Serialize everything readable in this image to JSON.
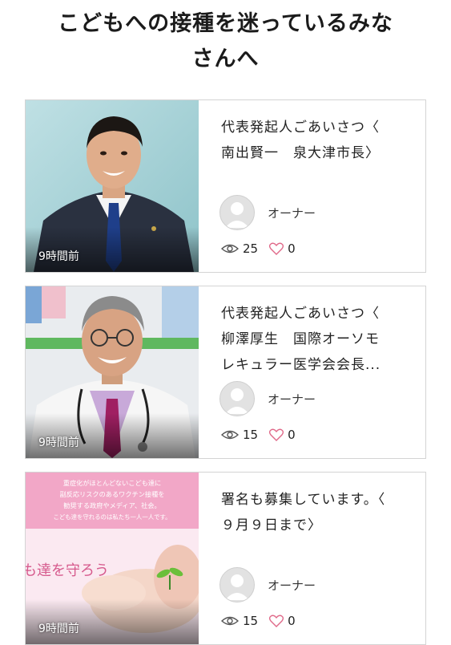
{
  "page": {
    "title_line1": "こどもへの接種を迷っているみな",
    "title_line2": "さんへ"
  },
  "posts": [
    {
      "title_line1": "代表発起人ごあいさつ〈",
      "title_line2": "南出賢一　泉大津市長〉",
      "title_line3": "",
      "time": "9時間前",
      "author": "オーナー",
      "views": "25",
      "likes": "0"
    },
    {
      "title_line1": "代表発起人ごあいさつ〈",
      "title_line2": "柳澤厚生　国際オーソモ",
      "title_line3": "レキュラー医学会会長...",
      "time": "9時間前",
      "author": "オーナー",
      "views": "15",
      "likes": "0"
    },
    {
      "title_line1": "署名も募集しています。〈",
      "title_line2": "９月９日まで〉",
      "title_line3": "",
      "time": "9時間前",
      "author": "オーナー",
      "views": "15",
      "likes": "0",
      "image_text": {
        "line1": "重症化がほとんどないこども達に",
        "line2": "副反応リスクのあるワクチン接種を",
        "line3": "勧奨する政府やメディア、社会。",
        "line4": "こども達を守れるのは私たち一人一人です。",
        "overlay": "も達を守ろう"
      }
    }
  ],
  "colors": {
    "heart": "#e06a8a",
    "eye": "#555555",
    "pink_banner": "#f2a7c7"
  },
  "icons": {
    "views": "eye-icon",
    "likes": "heart-icon",
    "avatar": "default-user-avatar"
  }
}
